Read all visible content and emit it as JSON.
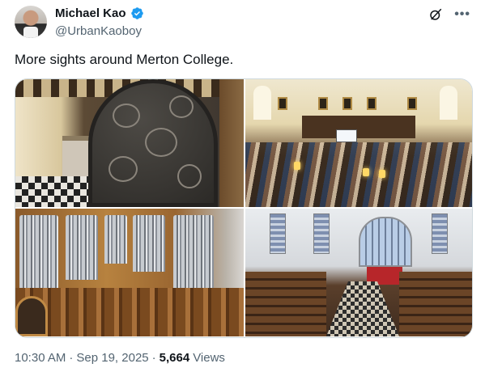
{
  "author": {
    "display_name": "Michael Kao",
    "handle": "@UrbanKaoboy"
  },
  "tweet": {
    "text": "More sights around Merton College."
  },
  "media": {
    "photos": [
      "door-photo",
      "dining-hall-photo",
      "organ-photo",
      "chapel-photo"
    ]
  },
  "meta": {
    "time": "10:30 AM",
    "sep1": "·",
    "date": "Sep 19, 2025",
    "sep2": "·",
    "views_count": "5,664",
    "views_label": "Views"
  },
  "icons": {
    "verified": "verified-badge-icon",
    "grok": "grok-icon",
    "more": "more-icon"
  },
  "colors": {
    "verified_blue": "#1d9bf0",
    "text_primary": "#0f1419",
    "text_secondary": "#536471",
    "border": "#cfd9de"
  }
}
